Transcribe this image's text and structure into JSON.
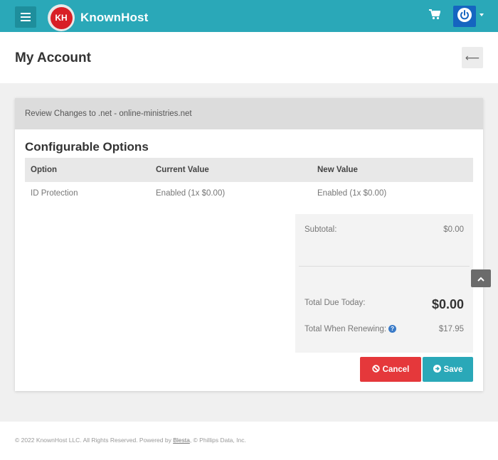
{
  "nav": {
    "brand": "KnownHost",
    "logo_initials": "KH",
    "icons": [
      "hamburger-icon",
      "cart-icon",
      "power-icon"
    ]
  },
  "page": {
    "title": "My Account",
    "back_symbol": "⟵"
  },
  "card": {
    "header": "Review Changes to .net - online-ministries.net",
    "section_title": "Configurable Options",
    "columns": [
      "Option",
      "Current Value",
      "New Value"
    ],
    "rows": [
      {
        "option": "ID Protection",
        "current": "Enabled (1x $0.00)",
        "new": "Enabled (1x $0.00)"
      }
    ],
    "summary": {
      "subtotal_label": "Subtotal:",
      "subtotal_value": "$0.00",
      "total_due_label": "Total Due Today:",
      "total_due_value": "$0.00",
      "renewing_label": "Total When Renewing:",
      "renewing_value": "$17.95",
      "help_symbol": "?"
    },
    "buttons": {
      "cancel": "Cancel",
      "save": "Save"
    }
  },
  "footer": {
    "text_before": "© 2022 KnownHost LLC. All Rights Reserved. Powered by ",
    "link": "Blesta",
    "text_after": ", © Phillips Data, Inc."
  },
  "colors": {
    "brand": "#2aa8b8",
    "danger": "#e5383b",
    "power": "#1565c0"
  }
}
